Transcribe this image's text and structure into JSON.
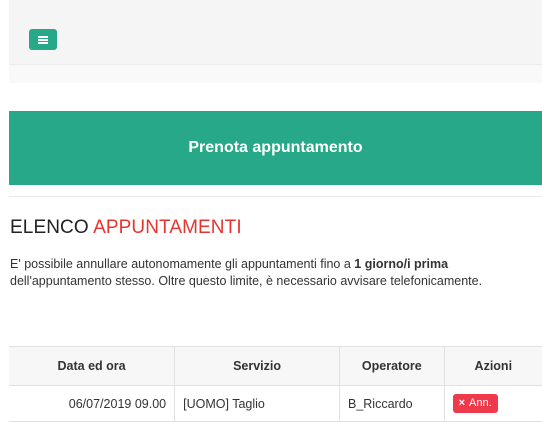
{
  "header": {
    "menu_icon": "hamburger-icon"
  },
  "banner": {
    "label": "Prenota appuntamento"
  },
  "section": {
    "title_prefix": "ELENCO",
    "title_highlight": "APPUNTAMENTI",
    "highlight_color": "#e8342e"
  },
  "info": {
    "text_before": "E' possibile annullare autonomamente gli appuntamenti fino a",
    "text_bold": "1 giorno/i prima",
    "text_after": "dell'appuntamento stesso. Oltre questo limite, è necessario avvisare telefonicamente."
  },
  "table": {
    "headers": [
      "Data ed ora",
      "Servizio",
      "Operatore",
      "Azioni"
    ],
    "rows": [
      {
        "date": "06/07/2019 09.00",
        "service": "[UOMO] Taglio",
        "operator": "B_Riccardo",
        "action_label": "Ann.",
        "action_icon": "times-icon"
      }
    ]
  },
  "colors": {
    "accent": "#26a889",
    "danger": "#ee3a4a"
  }
}
